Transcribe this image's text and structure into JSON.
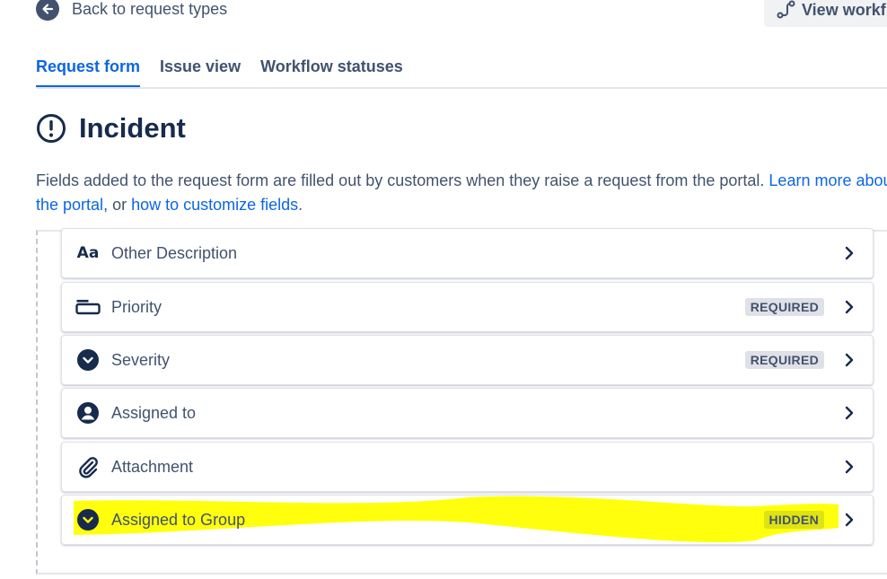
{
  "header": {
    "back_label": "Back to request types",
    "view_workflow_label": "View workf"
  },
  "tabs": [
    {
      "label": "Request form",
      "active": true
    },
    {
      "label": "Issue view",
      "active": false
    },
    {
      "label": "Workflow statuses",
      "active": false
    }
  ],
  "page": {
    "title": "Incident",
    "title_icon": "exclamation-circle-icon",
    "desc_text": "Fields added to the request form are filled out by customers when they raise a request from the portal. ",
    "desc_link1": "Learn more about the portal",
    "desc_mid": ", or ",
    "desc_link2": "how to customize fields",
    "desc_end": "."
  },
  "fields": [
    {
      "label": "Other Description",
      "icon": "text-field-icon",
      "badge": ""
    },
    {
      "label": "Priority",
      "icon": "priority-field-icon",
      "badge": "REQUIRED"
    },
    {
      "label": "Severity",
      "icon": "dropdown-circle-icon",
      "badge": "REQUIRED"
    },
    {
      "label": "Assigned to",
      "icon": "user-circle-icon",
      "badge": ""
    },
    {
      "label": "Attachment",
      "icon": "paperclip-icon",
      "badge": ""
    },
    {
      "label": "Assigned to Group",
      "icon": "dropdown-circle-icon",
      "badge": "HIDDEN"
    }
  ],
  "colors": {
    "accent": "#0c66e4",
    "highlight": "#ffff00"
  }
}
